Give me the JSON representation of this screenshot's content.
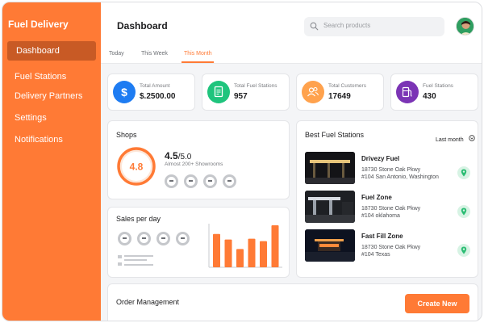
{
  "app": {
    "brand": "Fuel Delivery"
  },
  "sidebar": {
    "items": [
      {
        "label": "Dashboard"
      },
      {
        "label": "Fuel Stations"
      },
      {
        "label": "Delivery Partners"
      },
      {
        "label": "Settings"
      },
      {
        "label": "Notifications"
      }
    ]
  },
  "header": {
    "title": "Dashboard",
    "search_placeholder": "Search products"
  },
  "tabs": [
    {
      "label": "Today"
    },
    {
      "label": "This Week"
    },
    {
      "label": "This Month"
    }
  ],
  "stats": [
    {
      "label": "Total Amount",
      "value": "$.2500.00",
      "icon": "dollar-icon",
      "color": "#1e7cf2"
    },
    {
      "label": "Total Fuel Stations",
      "value": "957",
      "icon": "document-icon",
      "color": "#1fc47d"
    },
    {
      "label": "Total Customers",
      "value": "17649",
      "icon": "users-icon",
      "color": "#ffa24d"
    },
    {
      "label": "Fuel Stations",
      "value": "430",
      "icon": "fuel-pump-icon",
      "color": "#7b34b5"
    }
  ],
  "shops": {
    "title": "Shops",
    "rating_ring": "4.8",
    "rating_main": "4.5",
    "rating_total": "/5.0",
    "subtitle": "Almost 200+ Showrooms"
  },
  "sales": {
    "title": "Sales per day"
  },
  "chart_data": {
    "type": "bar",
    "values": [
      42,
      35,
      23,
      36,
      33,
      53
    ]
  },
  "best_stations": {
    "title": "Best  Fuel Stations",
    "filter": "Last month",
    "items": [
      {
        "name": "Drivezy Fuel",
        "line1": "18730 Stone Oak Pkwy",
        "line2": "#104 San Antonio, Washington"
      },
      {
        "name": "Fuel Zone",
        "line1": "18730 Stone Oak Pkwy",
        "line2": "#104 oklahoma"
      },
      {
        "name": "Fast Fill Zone",
        "line1": "18730 Stone Oak Pkwy",
        "line2": "#104 Texas"
      }
    ]
  },
  "orders": {
    "title": "Order Management",
    "create_label": "Create New"
  },
  "colors": {
    "accent": "#ff7a35",
    "sidebar_active": "#c85a25",
    "pin_green": "#2bbd73"
  }
}
